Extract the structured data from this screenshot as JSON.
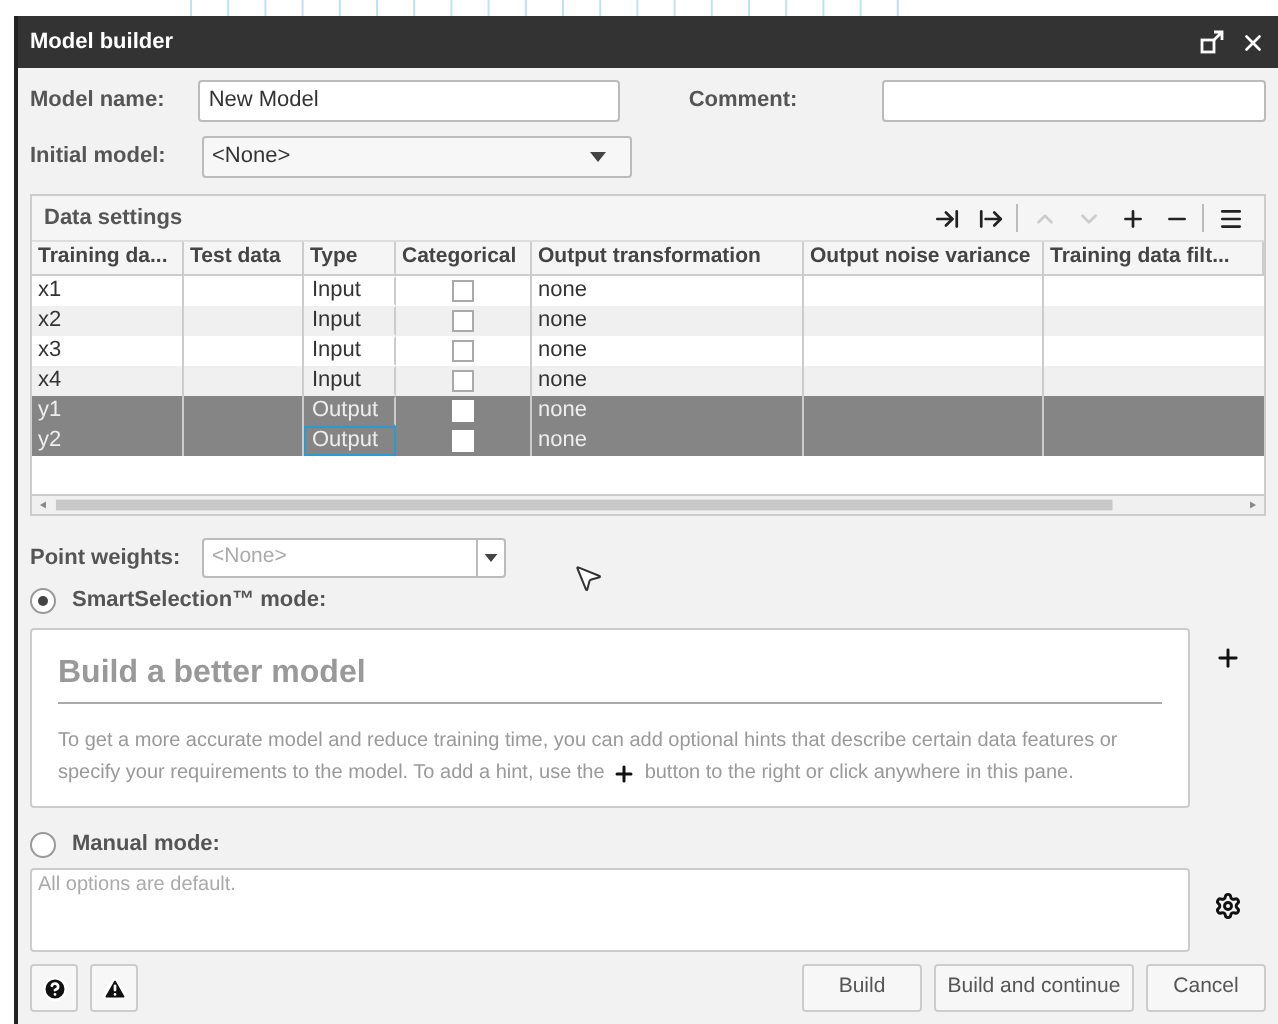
{
  "window": {
    "title": "Model builder"
  },
  "model_name": {
    "label": "Model name:",
    "value": "New Model"
  },
  "comment": {
    "label": "Comment:"
  },
  "initial_model": {
    "label": "Initial model:",
    "value": "<None>"
  },
  "data_settings": {
    "title": "Data settings",
    "toolbar_buttons": [
      {
        "disabled": false
      },
      {
        "disabled": false
      },
      {
        "disabled": true
      },
      {
        "disabled": true
      },
      {
        "disabled": false
      },
      {
        "disabled": false
      },
      {
        "disabled": false
      }
    ],
    "columns": [
      "Training da...",
      "Test data",
      "Type",
      "Categorical",
      "Output transformation",
      "Output noise variance",
      "Training data filt..."
    ],
    "rows": [
      {
        "name": "x1",
        "type": "Input",
        "categorical": false,
        "transformation": "none",
        "selected": false,
        "focused": false
      },
      {
        "name": "x2",
        "type": "Input",
        "categorical": false,
        "transformation": "none",
        "selected": false,
        "focused": false
      },
      {
        "name": "x3",
        "type": "Input",
        "categorical": false,
        "transformation": "none",
        "selected": false,
        "focused": false
      },
      {
        "name": "x4",
        "type": "Input",
        "categorical": false,
        "transformation": "none",
        "selected": false,
        "focused": false
      },
      {
        "name": "y1",
        "type": "Output",
        "categorical": false,
        "transformation": "none",
        "selected": true,
        "focused": false
      },
      {
        "name": "y2",
        "type": "Output",
        "categorical": false,
        "transformation": "none",
        "selected": true,
        "focused": true
      }
    ]
  },
  "point_weights": {
    "label": "Point weights:",
    "placeholder": "<None>",
    "disabled": true
  },
  "smart_mode": {
    "label": "SmartSelection™ mode:",
    "selected": true,
    "heading": "Build a better model",
    "text_line_1": "To get a more accurate model and reduce training time, you can add optional hints that describe certain data features or",
    "text_before": "specify your requirements to the model. To add a hint, use the",
    "text_after": "button to the right or click anywhere in this pane."
  },
  "manual_mode": {
    "label": "Manual mode:",
    "selected": false,
    "placeholder": "All options are default."
  },
  "buttons": [
    "Build",
    "Build and continue",
    "Cancel"
  ]
}
